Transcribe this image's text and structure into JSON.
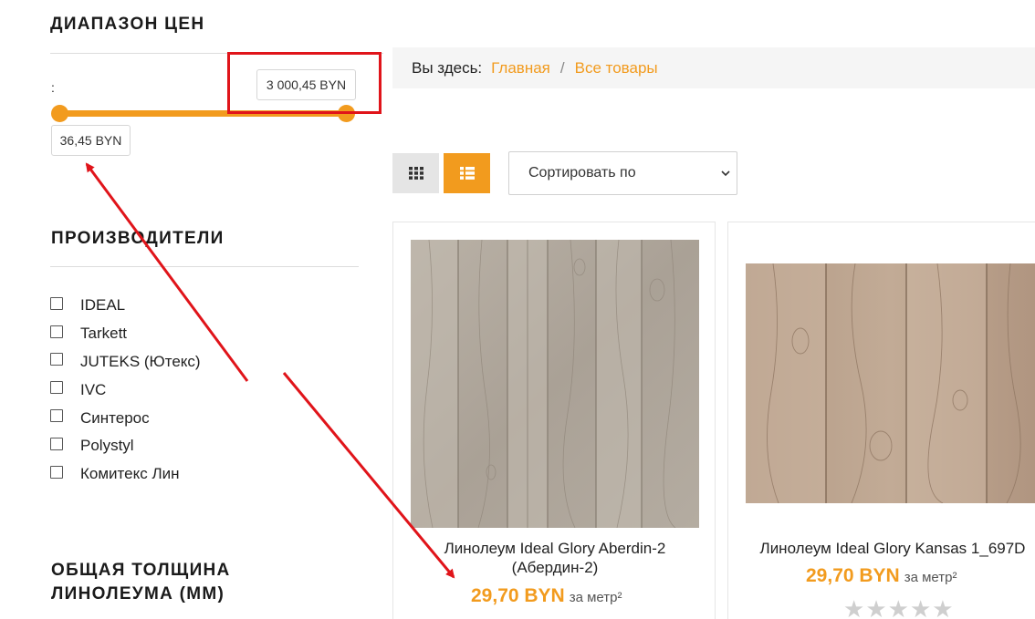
{
  "sidebar": {
    "price_heading": "ДИАПАЗОН ЦЕН",
    "price_colon": ":",
    "price_max": "3 000,45 BYN",
    "price_min": "36,45 BYN",
    "manufacturers_heading": "ПРОИЗВОДИТЕЛИ",
    "manufacturers": [
      {
        "label": "IDEAL",
        "checked": false
      },
      {
        "label": "Tarkett",
        "checked": false
      },
      {
        "label": "JUTEKS (Ютекс)",
        "checked": false
      },
      {
        "label": "IVC",
        "checked": false
      },
      {
        "label": "Синтерос",
        "checked": false
      },
      {
        "label": "Polystyl",
        "checked": false
      },
      {
        "label": "Комитекс Лин",
        "checked": false
      }
    ],
    "thickness_heading_line1": "ОБЩАЯ ТОЛЩИНА",
    "thickness_heading_line2": "ЛИНОЛЕУМА (ММ)"
  },
  "breadcrumb": {
    "prefix": "Вы здесь:",
    "home": "Главная",
    "separator": "/",
    "current": "Все товары"
  },
  "toolbar": {
    "grid_icon": "grid-icon",
    "list_icon": "list-icon",
    "sort_label": "Сортировать по"
  },
  "products": [
    {
      "name_line1": "Линолеум Ideal Glory Aberdin-2",
      "name_line2": "(Абердин-2)",
      "price": "29,70 BYN",
      "unit": "за метр²"
    },
    {
      "name_line1": "Линолеум Ideal Glory Kansas 1_697D",
      "name_line2": "",
      "price": "29,70 BYN",
      "unit": "за метр²",
      "rating": 0
    }
  ],
  "colors": {
    "accent": "#f29b1e",
    "annotation_red": "#e0141a",
    "breadcrumb_bg": "#f5f5f5"
  }
}
